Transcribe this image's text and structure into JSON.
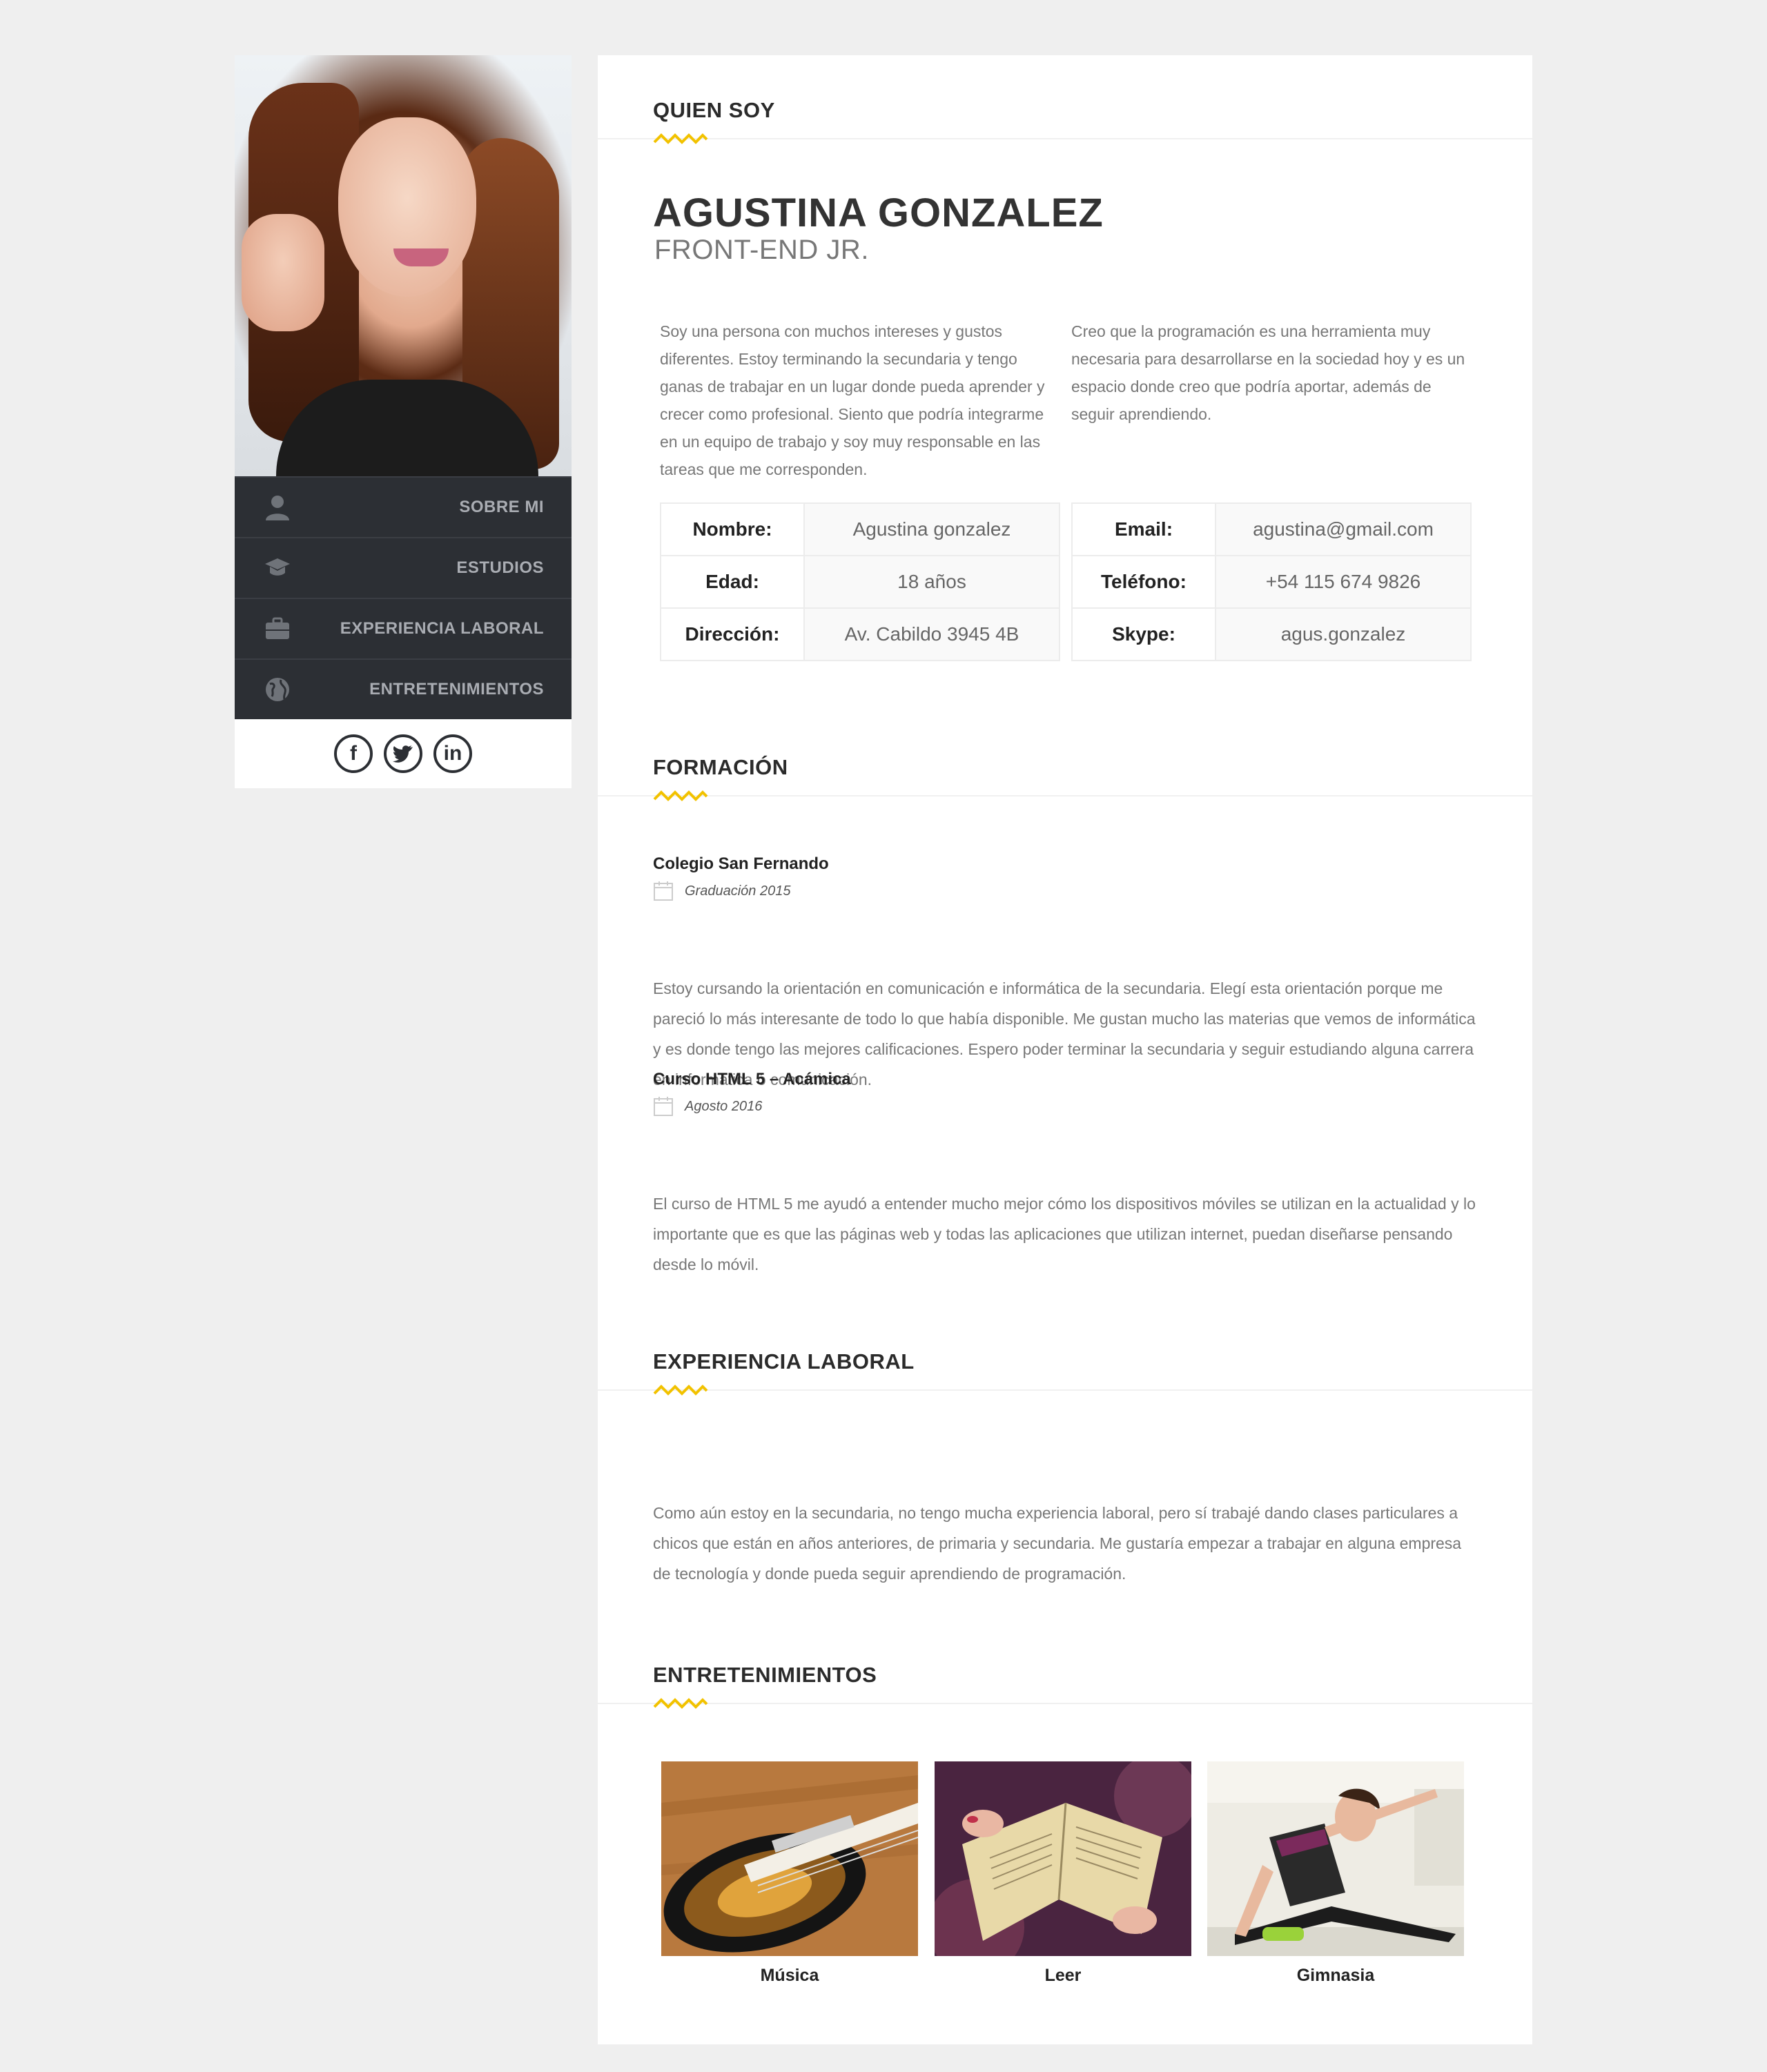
{
  "sidebar": {
    "nav": [
      {
        "label": "SOBRE MI",
        "icon": "user-icon"
      },
      {
        "label": "ESTUDIOS",
        "icon": "graduation-cap-icon"
      },
      {
        "label": "EXPERIENCIA LABORAL",
        "icon": "briefcase-icon"
      },
      {
        "label": "ENTRETENIMIENTOS",
        "icon": "globe-icon"
      }
    ],
    "social": [
      {
        "icon": "facebook-icon",
        "glyph": "f"
      },
      {
        "icon": "twitter-icon",
        "glyph": "🐦"
      },
      {
        "icon": "linkedin-icon",
        "glyph": "in"
      }
    ]
  },
  "about": {
    "title": "QUIEN SOY",
    "name": "AGUSTINA GONZALEZ",
    "role": "FRONT-END JR.",
    "intro_1": "Soy una persona con muchos intereses y gustos diferentes. Estoy terminando la secundaria y tengo ganas de trabajar en un lugar donde pueda aprender y crecer como profesional. Siento que podría integrarme en un equipo de trabajo y soy muy responsable en las tareas que me corresponden.",
    "intro_2": "Creo que la programación es una herramienta muy necesaria para desarrollarse en la sociedad hoy y es un espacio donde creo que podría aportar, además de seguir aprendiendo.",
    "info_left": [
      {
        "key": "Nombre:",
        "value": "Agustina gonzalez"
      },
      {
        "key": "Edad:",
        "value": "18 años"
      },
      {
        "key": "Dirección:",
        "value": "Av. Cabildo 3945 4B"
      }
    ],
    "info_right": [
      {
        "key": "Email:",
        "value": "agustina@gmail.com"
      },
      {
        "key": "Teléfono:",
        "value": "+54 115 674 9826"
      },
      {
        "key": "Skype:",
        "value": "agus.gonzalez"
      }
    ]
  },
  "education": {
    "title": "FORMACIÓN",
    "entries": [
      {
        "title": "Colegio San Fernando",
        "date": "Graduación 2015",
        "text": "Estoy cursando la orientación en comunicación e informática de la secundaria. Elegí esta orientación porque me pareció lo más interesante de todo lo que había disponible. Me gustan mucho las materias que vemos de informática y es donde tengo las mejores calificaciones. Espero poder terminar la secundaria y seguir estudiando alguna carrera en informática ó comunicación."
      },
      {
        "title": "Curso HTML 5 – Acámica",
        "date": "Agosto 2016",
        "text": "El curso de HTML 5 me ayudó a entender mucho mejor cómo los dispositivos móviles se utilizan en la actualidad y lo importante que es que las páginas web y todas las aplicaciones que utilizan internet, puedan diseñarse pensando desde lo móvil."
      }
    ]
  },
  "experience": {
    "title": "EXPERIENCIA LABORAL",
    "text": "Como aún estoy en la secundaria, no tengo mucha experiencia laboral, pero sí trabajé dando clases particulares a chicos que están en años anteriores, de primaria y secundaria. Me gustaría empezar a trabajar en alguna empresa de tecnología y donde pueda seguir aprendiendo de programación."
  },
  "hobbies": {
    "title": "ENTRETENIMIENTOS",
    "items": [
      {
        "label": "Música"
      },
      {
        "label": "Leer"
      },
      {
        "label": "Gimnasia"
      }
    ]
  },
  "colors": {
    "accent": "#f2c200",
    "sidebar_bg": "#2c2f34",
    "page_bg": "#efefef"
  }
}
